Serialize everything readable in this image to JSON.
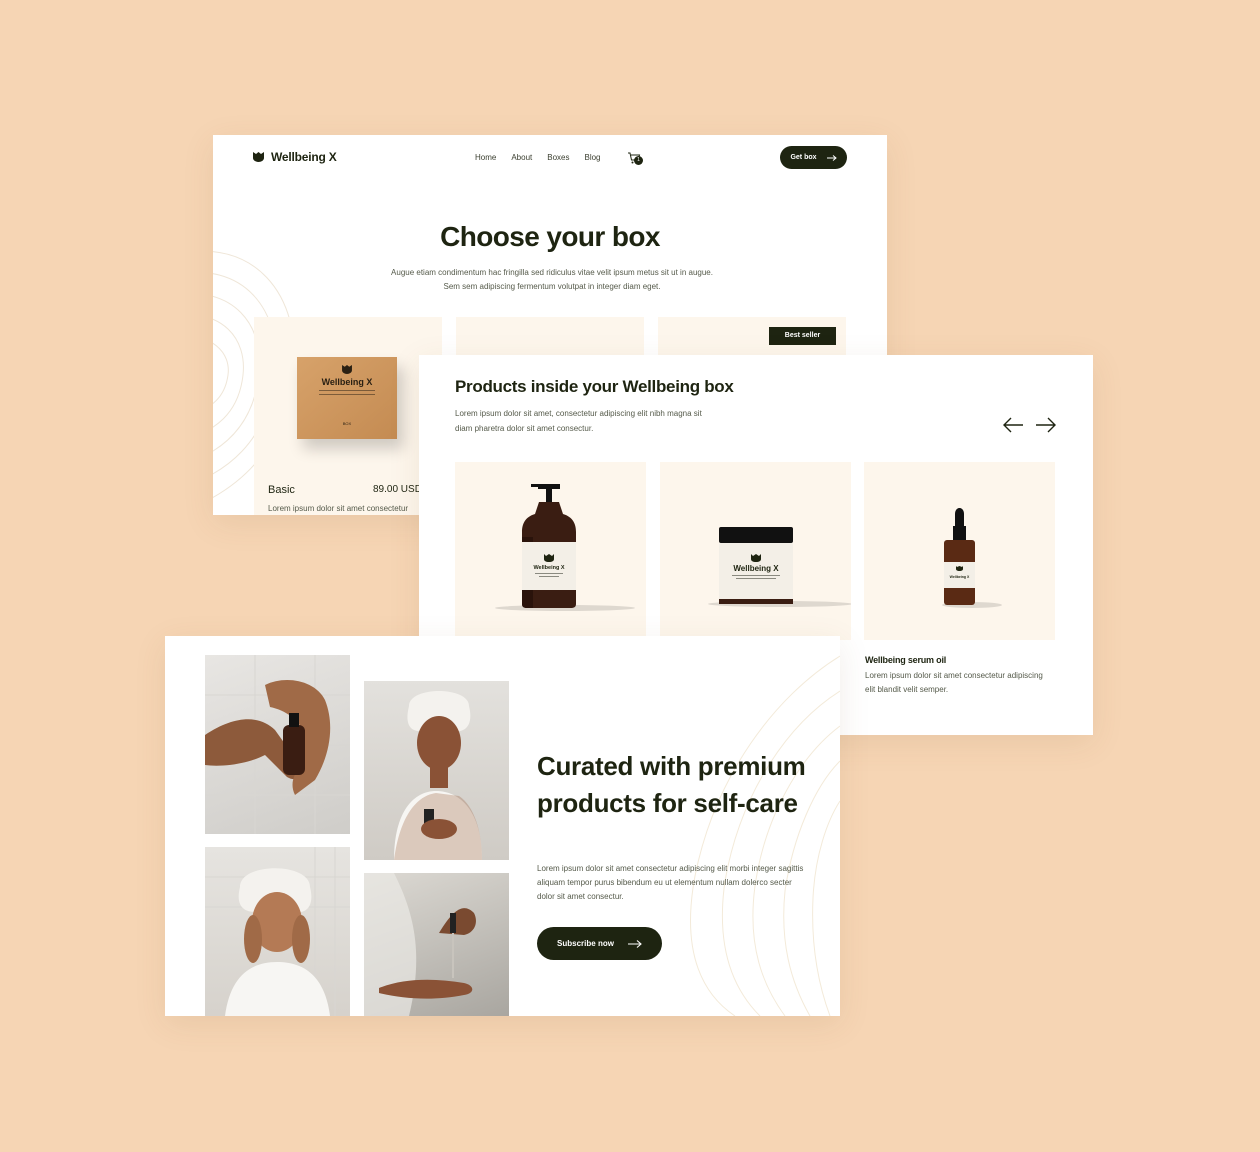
{
  "header": {
    "brand": "Wellbeing X",
    "nav": [
      "Home",
      "About",
      "Boxes",
      "Blog"
    ],
    "cart_count": "1",
    "cta_label": "Get box"
  },
  "choose": {
    "title": "Choose your box",
    "description": "Augue etiam condimentum hac fringilla sed ridiculus vitae velit ipsum metus sit ut in augue. Sem sem adipiscing fermentum volutpat in integer diam eget.",
    "badge": "Best seller",
    "box_logo": "Wellbeing X",
    "box_label": "BOX",
    "plans": [
      {
        "name": "Basic",
        "price": "89.00 USD",
        "description": "Lorem ipsum dolor sit amet consectetur"
      }
    ]
  },
  "products": {
    "title": "Products inside your Wellbeing box",
    "description": "Lorem ipsum dolor sit amet, consectetur adipiscing elit nibh magna sit diam pharetra dolor sit amet consectur.",
    "product_label": "Wellbeing X",
    "featured": {
      "name": "Wellbeing serum oil",
      "description": "Lorem ipsum dolor sit amet consectetur adipiscing elit blandit velit semper."
    }
  },
  "curated": {
    "title": "Curated with premium products for self-care",
    "description": "Lorem ipsum dolor sit amet consectetur adipiscing elit morbi integer sagittis aliquam tempor purus bibendum eu ut elementum nullam dolerco secter dolor sit amet consectur.",
    "cta_label": "Subscribe now"
  },
  "colors": {
    "background": "#f6d5b4",
    "dark": "#1e2411",
    "cream": "#fdf6ec",
    "kraft": "#c48b52"
  },
  "icons": [
    "logo-icon",
    "cart-icon",
    "arrow-right-icon",
    "arrow-left-icon"
  ]
}
